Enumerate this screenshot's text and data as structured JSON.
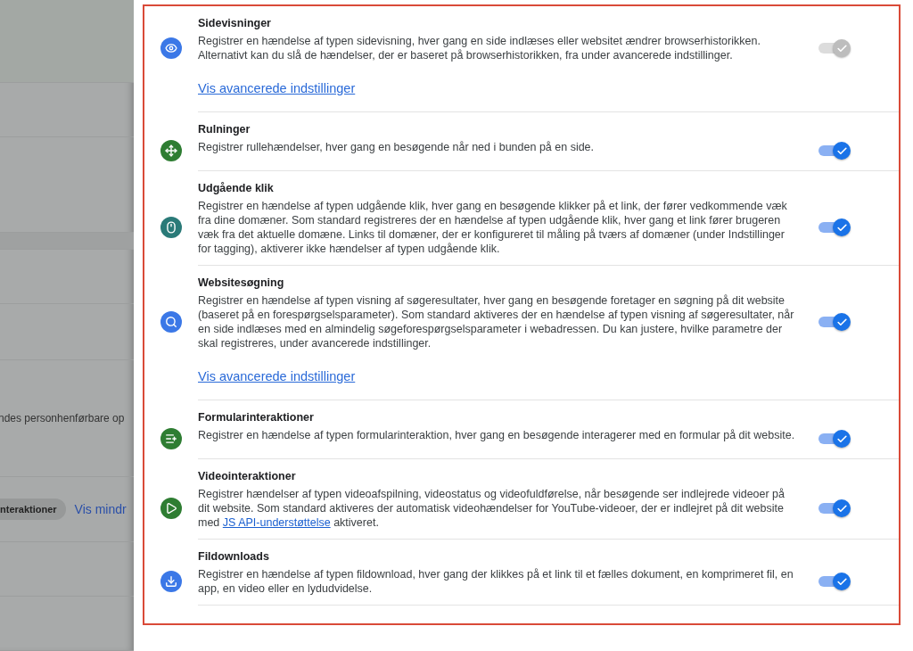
{
  "background": {
    "partial_text": "ndes personhenførbare op",
    "chip": "nteraktioner",
    "link": "Vis mindr"
  },
  "events": [
    {
      "color": "#3b78e7",
      "title": "Sidevisninger",
      "description": [
        {
          "kind": "text",
          "text": "Registrer en hændelse af typen sidevisning, hver gang en side indlæses eller websitet ændrer browserhistorikken. Alternativt kan du slå de hændelser, der er baseret på browserhistorikken, fra under avancerede indstillinger."
        }
      ],
      "link": "Vis avancerede indstillinger",
      "on": true,
      "disabled": true
    },
    {
      "color": "#2e7d32",
      "title": "Rulninger",
      "description": [
        {
          "kind": "text",
          "text": "Registrer rullehændelser, hver gang en besøgende når ned i bunden på en side."
        }
      ],
      "on": true,
      "disabled": false
    },
    {
      "color": "#2a7a78",
      "title": "Udgående klik",
      "description": [
        {
          "kind": "text",
          "text": "Registrer en hændelse af typen udgående klik, hver gang en besøgende klikker på et link, der fører vedkommende væk fra dine domæner. Som standard registreres der en hændelse af typen udgående klik, hver gang et link fører brugeren væk fra det aktuelle domæne. Links til domæner, der er konfigureret til måling på tværs af domæner (under Indstillinger for tagging), aktiverer ikke hændelser af typen udgående klik."
        }
      ],
      "on": true,
      "disabled": false
    },
    {
      "color": "#3b78e7",
      "title": "Websitesøgning",
      "description": [
        {
          "kind": "text",
          "text": "Registrer en hændelse af typen visning af søgeresultater, hver gang en besøgende foretager en søgning på dit website (baseret på en forespørgselsparameter). Som standard aktiveres der en hændelse af typen visning af søgeresultater, når en side indlæses med en almindelig søgeforespørgselsparameter i webadressen. Du kan justere, hvilke parametre der skal registreres, under avancerede indstillinger."
        }
      ],
      "link": "Vis avancerede indstillinger",
      "on": true,
      "disabled": false
    },
    {
      "color": "#2e7d32",
      "title": "Formularinteraktioner",
      "description": [
        {
          "kind": "text",
          "text": "Registrer en hændelse af typen formularinteraktion, hver gang en besøgende interagerer med en formular på dit website."
        }
      ],
      "on": true,
      "disabled": false
    },
    {
      "color": "#2e7d32",
      "title": "Videointeraktioner",
      "description": [
        {
          "kind": "text",
          "text": "Registrer hændelser af typen videoafspilning, videostatus og videofuldførelse, når besøgende ser indlejrede videoer på dit website. Som standard aktiveres der automatisk videohændelser for YouTube-videoer, der er indlejret på dit website med "
        },
        {
          "kind": "link",
          "text": "JS API-understøttelse"
        },
        {
          "kind": "text",
          "text": " aktiveret."
        }
      ],
      "on": true,
      "disabled": false
    },
    {
      "color": "#3b78e7",
      "title": "Fildownloads",
      "description": [
        {
          "kind": "text",
          "text": "Registrer en hændelse af typen fildownload, hver gang der klikkes på et link til et fælles dokument, en komprimeret fil, en app, en video eller en lydudvidelse."
        }
      ],
      "on": true,
      "disabled": false
    }
  ]
}
